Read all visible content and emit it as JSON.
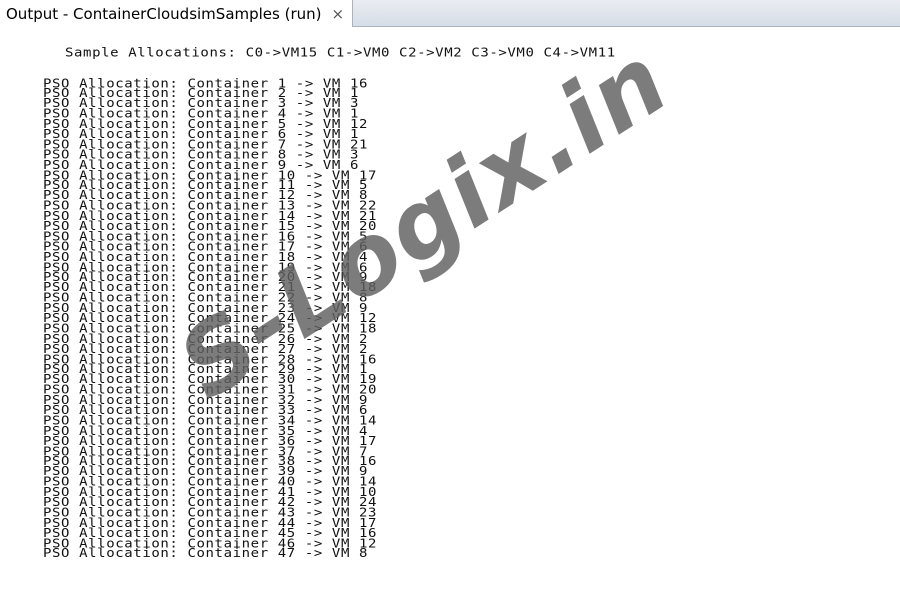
{
  "output_tab": {
    "title": "Output - ContainerCloudsimSamples (run)",
    "close_glyph": "×"
  },
  "console": {
    "header": "Sample Allocations: C0->VM15 C1->VM0 C2->VM2 C3->VM0 C4->VM11",
    "lines": [
      "PSO Allocation: Container 1 -> VM 16",
      "PSO Allocation: Container 2 -> VM 1",
      "PSO Allocation: Container 3 -> VM 3",
      "PSO Allocation: Container 4 -> VM 1",
      "PSO Allocation: Container 5 -> VM 12",
      "PSO Allocation: Container 6 -> VM 1",
      "PSO Allocation: Container 7 -> VM 21",
      "PSO Allocation: Container 8 -> VM 3",
      "PSO Allocation: Container 9 -> VM 6",
      "PSO Allocation: Container 10 -> VM 17",
      "PSO Allocation: Container 11 -> VM 5",
      "PSO Allocation: Container 12 -> VM 8",
      "PSO Allocation: Container 13 -> VM 22",
      "PSO Allocation: Container 14 -> VM 21",
      "PSO Allocation: Container 15 -> VM 20",
      "PSO Allocation: Container 16 -> VM 5",
      "PSO Allocation: Container 17 -> VM 6",
      "PSO Allocation: Container 18 -> VM 4",
      "PSO Allocation: Container 19 -> VM 6",
      "PSO Allocation: Container 20 -> VM 9",
      "PSO Allocation: Container 21 -> VM 18",
      "PSO Allocation: Container 22 -> VM 8",
      "PSO Allocation: Container 23 -> VM 9",
      "PSO Allocation: Container 24 -> VM 12",
      "PSO Allocation: Container 25 -> VM 18",
      "PSO Allocation: Container 26 -> VM 2",
      "PSO Allocation: Container 27 -> VM 2",
      "PSO Allocation: Container 28 -> VM 16",
      "PSO Allocation: Container 29 -> VM 1",
      "PSO Allocation: Container 30 -> VM 19",
      "PSO Allocation: Container 31 -> VM 20",
      "PSO Allocation: Container 32 -> VM 9",
      "PSO Allocation: Container 33 -> VM 6",
      "PSO Allocation: Container 34 -> VM 14",
      "PSO Allocation: Container 35 -> VM 4",
      "PSO Allocation: Container 36 -> VM 17",
      "PSO Allocation: Container 37 -> VM 7",
      "PSO Allocation: Container 38 -> VM 16",
      "PSO Allocation: Container 39 -> VM 9",
      "PSO Allocation: Container 40 -> VM 14",
      "PSO Allocation: Container 41 -> VM 10",
      "PSO Allocation: Container 42 -> VM 24",
      "PSO Allocation: Container 43 -> VM 23",
      "PSO Allocation: Container 44 -> VM 17",
      "PSO Allocation: Container 45 -> VM 16",
      "PSO Allocation: Container 46 -> VM 12",
      "PSO Allocation: Container 47 -> VM 8"
    ]
  },
  "watermark": {
    "text": "S-Logix.in",
    "color": "#5f5f5f"
  }
}
